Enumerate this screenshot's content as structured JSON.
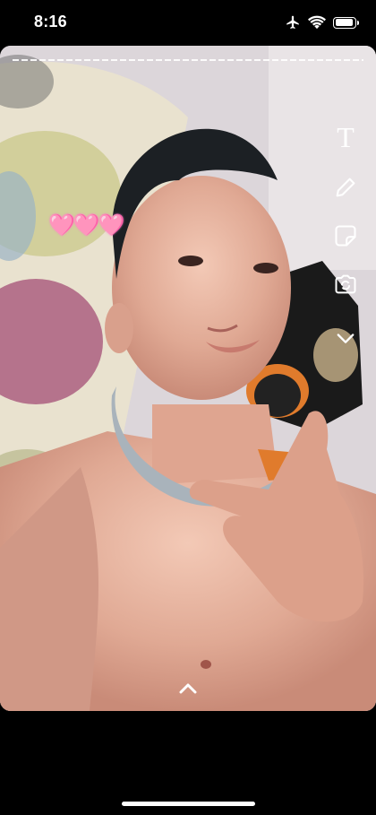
{
  "status_bar": {
    "time": "8:16",
    "icons": [
      "airplane-mode-icon",
      "wifi-icon",
      "battery-icon"
    ],
    "battery_level": 1.0
  },
  "story": {
    "progress_segments": "dashed",
    "sticker_hearts": "🩷🩷🩷"
  },
  "tools": {
    "text_label": "T",
    "icons": [
      "text-tool-icon",
      "pencil-icon",
      "sticker-icon",
      "camera-flip-icon",
      "chevron-down-icon"
    ]
  },
  "swipe_up_icon": "chevron-up-icon",
  "colors": {
    "background": "#000000",
    "heart_sticker": "#ff4fc1"
  }
}
